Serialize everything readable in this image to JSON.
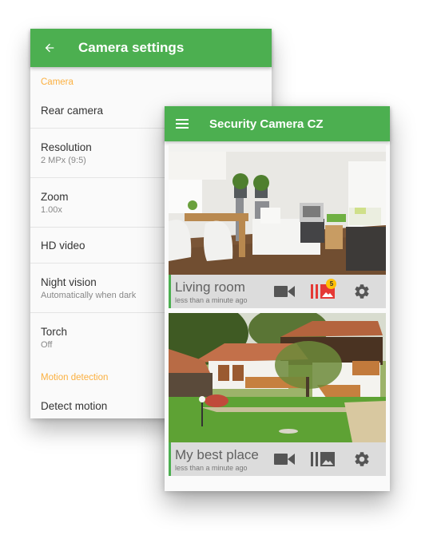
{
  "settings": {
    "title": "Camera settings",
    "back_icon": "arrow-left-icon",
    "sections": [
      {
        "header": "Camera",
        "items": [
          {
            "title": "Rear camera",
            "summary": null
          },
          {
            "title": "Resolution",
            "summary": "2 MPx (9:5)"
          },
          {
            "title": "Zoom",
            "summary": "1.00x"
          },
          {
            "title": "HD video",
            "summary": null
          },
          {
            "title": "Night vision",
            "summary": "Automatically when dark"
          },
          {
            "title": "Torch",
            "summary": "Off"
          }
        ]
      },
      {
        "header": "Motion detection",
        "items": [
          {
            "title": "Detect motion",
            "summary": null
          }
        ]
      }
    ]
  },
  "main": {
    "title": "Security Camera CZ",
    "menu_icon": "hamburger-menu-icon",
    "cameras": [
      {
        "name": "Living room",
        "updated": "less than a minute ago",
        "image": "living-room-interior",
        "gallery_badge": "5",
        "gallery_highlight": true
      },
      {
        "name": "My best place",
        "updated": "less than a minute ago",
        "image": "house-with-garden",
        "gallery_badge": null,
        "gallery_highlight": false
      }
    ],
    "icons": [
      "video-camera-icon",
      "gallery-icon",
      "gear-icon"
    ]
  },
  "colors": {
    "primary": "#4caf50",
    "accent": "#fbb040",
    "alert": "#e53935",
    "badge": "#ffc107",
    "icon": "#555555"
  }
}
